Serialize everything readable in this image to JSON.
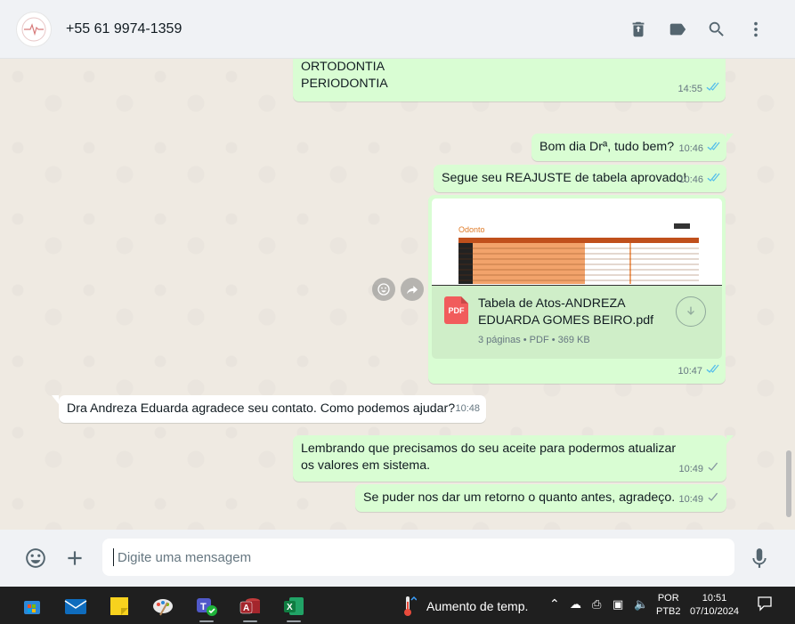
{
  "header": {
    "contact_name": "+55 61 9974-1359",
    "icons": [
      "delete-icon",
      "label-icon",
      "search-icon",
      "menu-icon"
    ]
  },
  "messages": [
    {
      "id": "m1",
      "direction": "out",
      "text": "ORTODONTIA\nPERIODONTIA",
      "time": "14:55",
      "status": "read"
    },
    {
      "id": "m2",
      "direction": "out",
      "text": "Bom dia Drª, tudo bem?",
      "time": "10:46",
      "status": "read"
    },
    {
      "id": "m3",
      "direction": "out",
      "text": "Segue seu REAJUSTE de tabela aprovado!",
      "time": "10:46",
      "status": "read"
    },
    {
      "id": "m4",
      "direction": "out",
      "type": "document",
      "file_name": "Tabela de Atos-ANDREZA EDUARDA GOMES BEIRO.pdf",
      "file_meta": "3 páginas • PDF • 369 KB",
      "file_badge": "PDF",
      "preview_logo": "Odonto",
      "time": "10:47",
      "status": "read"
    },
    {
      "id": "m5",
      "direction": "in",
      "text": "Dra Andreza Eduarda agradece seu contato. Como podemos ajudar?",
      "time": "10:48"
    },
    {
      "id": "m6",
      "direction": "out",
      "text": "Lembrando que precisamos do seu aceite para podermos atualizar os valores em sistema.",
      "time": "10:49",
      "status": "sent"
    },
    {
      "id": "m7",
      "direction": "out",
      "text": "Se puder nos dar um retorno o quanto antes, agradeço.",
      "time": "10:49",
      "status": "sent"
    }
  ],
  "composer": {
    "placeholder": "Digite uma mensagem"
  },
  "taskbar": {
    "weather_text": "Aumento de temp.",
    "language_top": "POR",
    "language_bottom": "PTB2",
    "time": "10:51",
    "date": "07/10/2024"
  },
  "colors": {
    "outgoing_bubble": "#d9fdd3",
    "incoming_bubble": "#ffffff",
    "chat_bg": "#efeae2",
    "read_tick": "#53bdeb",
    "pdf_red": "#f15c5c"
  }
}
